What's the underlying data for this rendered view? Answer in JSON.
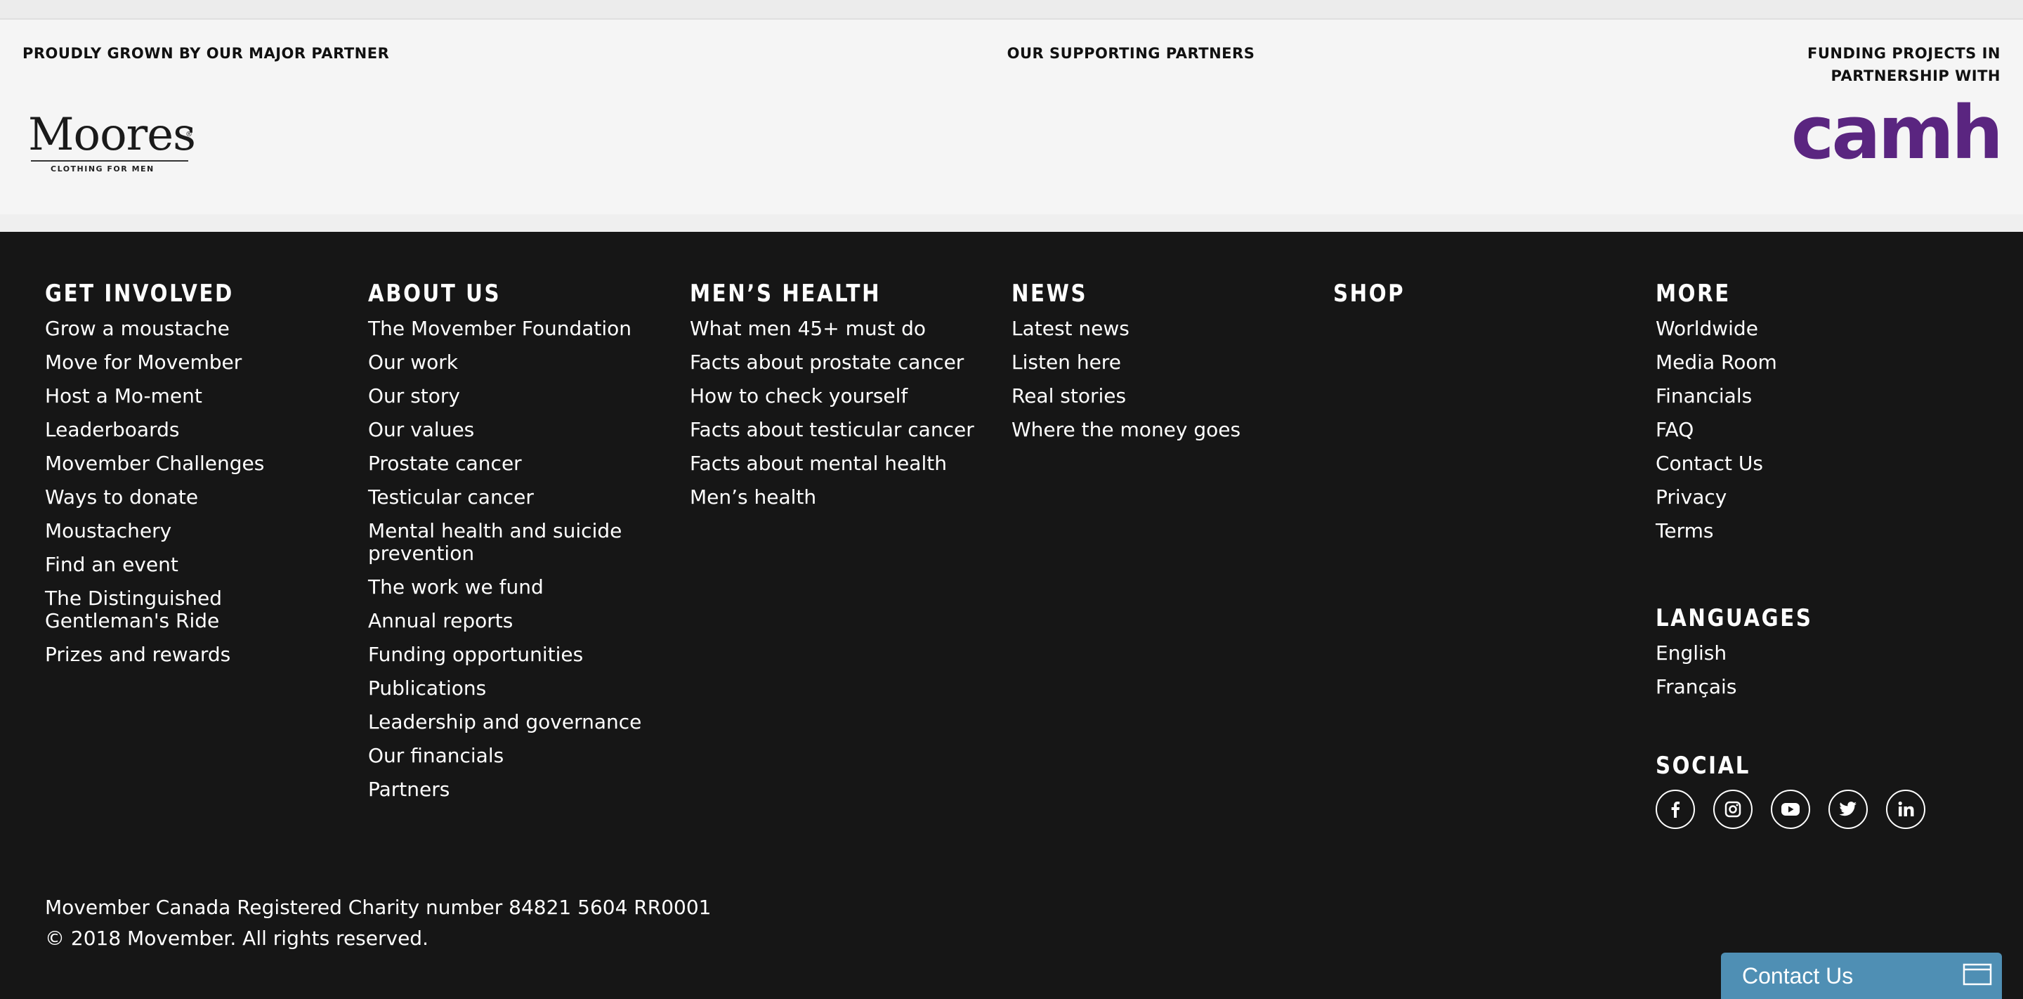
{
  "partners": {
    "major_label": "PROUDLY GROWN BY OUR MAJOR PARTNER",
    "supporting_label": "OUR SUPPORTING PARTNERS",
    "funding_label": "FUNDING PROJECTS IN PARTNERSHIP WITH",
    "moores": {
      "name": "Moores",
      "tagline": "CLOTHING FOR MEN"
    },
    "camh": {
      "name": "camh",
      "color": "#5a2580"
    }
  },
  "footer": {
    "columns": [
      {
        "heading": "GET INVOLVED",
        "items": [
          "Grow a moustache",
          "Move for Movember",
          "Host a Mo-ment",
          "Leaderboards",
          "Movember Challenges",
          "Ways to donate",
          "Moustachery",
          "Find an event",
          "The Distinguished Gentleman's Ride",
          "Prizes and rewards"
        ]
      },
      {
        "heading": "ABOUT US",
        "items": [
          "The Movember Foundation",
          "Our work",
          "Our story",
          "Our values",
          "Prostate cancer",
          "Testicular cancer",
          "Mental health and suicide prevention",
          "The work we fund",
          "Annual reports",
          "Funding opportunities",
          "Publications",
          "Leadership and governance",
          "Our financials",
          "Partners"
        ]
      },
      {
        "heading": "MEN’S HEALTH",
        "items": [
          "What men 45+ must do",
          "Facts about prostate cancer",
          "How to check yourself",
          "Facts about testicular cancer",
          "Facts about mental health",
          "Men’s health"
        ]
      },
      {
        "heading": "NEWS",
        "items": [
          "Latest news",
          "Listen here",
          "Real stories",
          "Where the money goes"
        ]
      },
      {
        "heading": "SHOP",
        "items": []
      },
      {
        "heading": "MORE",
        "items": [
          "Worldwide",
          "Media Room",
          "Financials",
          "FAQ",
          "Contact Us",
          "Privacy",
          "Terms"
        ]
      }
    ],
    "languages": {
      "heading": "LANGUAGES",
      "items": [
        "English",
        "Français"
      ]
    },
    "social": {
      "heading": "SOCIAL",
      "icons": [
        "facebook-icon",
        "instagram-icon",
        "youtube-icon",
        "twitter-icon",
        "linkedin-icon"
      ]
    },
    "legal": {
      "charity": "Movember Canada Registered Charity number 84821 5604 RR0001",
      "copyright": "© 2018 Movember. All rights reserved."
    }
  },
  "contact_tab": {
    "label": "Contact Us",
    "icon": "chat-window-icon",
    "color": "#4f8fb4"
  }
}
